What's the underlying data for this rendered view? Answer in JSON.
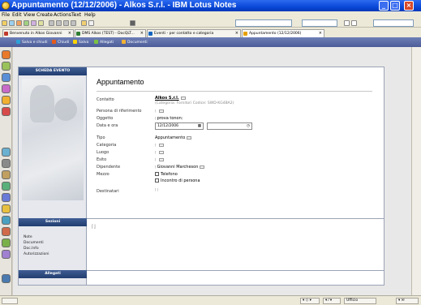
{
  "window": {
    "title": "Appuntamento (12/12/2006) - Alkos S.r.l. - IBM Lotus Notes"
  },
  "menu": [
    "File",
    "Edit",
    "View",
    "Create",
    "Actions",
    "Text",
    "Help"
  ],
  "tabs": [
    {
      "label": "Benvenuto in Alkos Giovanni",
      "color": "#c0392b"
    },
    {
      "label": "DMS Alkos (TEST) - DocQLT...",
      "color": "#2e7d32"
    },
    {
      "label": "Eventi - per contatto e categoria",
      "color": "#1565c0"
    },
    {
      "label": "Appuntamento (12/12/2006)",
      "color": "#e6a100"
    }
  ],
  "actions": [
    {
      "label": "Salva e chiudi",
      "color": "#2ea0d8"
    },
    {
      "label": "Chiudi",
      "color": "#e85a1a"
    },
    {
      "label": "Salva",
      "color": "#ffd400"
    },
    {
      "label": "Allegati",
      "color": "#7cc242"
    },
    {
      "label": "Documenti",
      "color": "#f2b233"
    }
  ],
  "form": {
    "side_header": "SCHEDA EVENTO",
    "title": "Appuntamento",
    "sections_header": "Sezioni",
    "sections": [
      "Note",
      "Documenti",
      "Doc.Info",
      "Autorizzazioni"
    ],
    "attachments_header": "Allegati",
    "fields": {
      "contatto_label": "Contatto",
      "contatto_value": "Alkos S.r.l.",
      "contatto_sub": "(Categoria: Fornitori Codice: SWD-KG4BA2)",
      "persona_label": "Persona di riferimento",
      "oggetto_label": "Oggetto",
      "oggetto_value": "prova tonon",
      "data_label": "Data e ora",
      "data_value": "12/12/2006",
      "tipo_label": "Tipo",
      "tipo_value": "Appuntamento",
      "categoria_label": "Categoria",
      "luogo_label": "Luogo",
      "esito_label": "Esito",
      "dipendente_label": "Dipendente",
      "dipendente_value": "Giovanni Marcheson",
      "mezzo_label": "Mezzo",
      "mezzo_options": [
        "Telefono",
        "Incontro di persona"
      ],
      "destinatari_label": "Destinatari"
    }
  },
  "status": {
    "office": "Ufficio"
  },
  "dock_colors": [
    "#e87a2a",
    "#9ac25a",
    "#5a8fd8",
    "#c86ac8",
    "#f0b030",
    "#d84a4a",
    "#6ab0d0",
    "#8a8a8a",
    "#c0a060",
    "#5ab07a",
    "#6a7ad8",
    "#e8c040",
    "#4aa0c0",
    "#d06a4a",
    "#7ab04a",
    "#a080d0"
  ]
}
